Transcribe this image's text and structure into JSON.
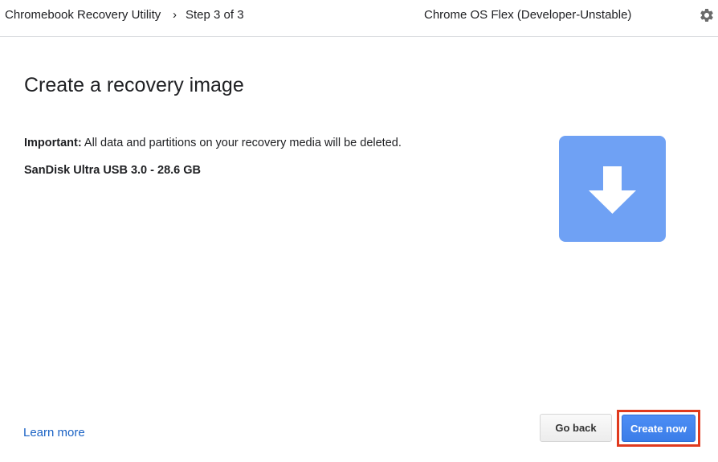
{
  "header": {
    "app_title": "Chromebook Recovery Utility",
    "breadcrumb_separator": "›",
    "step": "Step 3 of 3",
    "selected_image": "Chrome OS Flex (Developer-Unstable)",
    "settings_icon": "gear-icon"
  },
  "main": {
    "title": "Create a recovery image",
    "warning_label": "Important:",
    "warning_text": " All data and partitions on your recovery media will be deleted.",
    "device": "SanDisk Ultra USB 3.0 - 28.6 GB",
    "illustration_icon": "download-arrow-icon"
  },
  "footer": {
    "learn_more": "Learn more",
    "back_label": "Go back",
    "create_label": "Create now"
  },
  "colors": {
    "accent": "#3b7de8",
    "illustration": "#6fa1f4",
    "link": "#1a62c4",
    "highlight": "#e03a1e"
  }
}
